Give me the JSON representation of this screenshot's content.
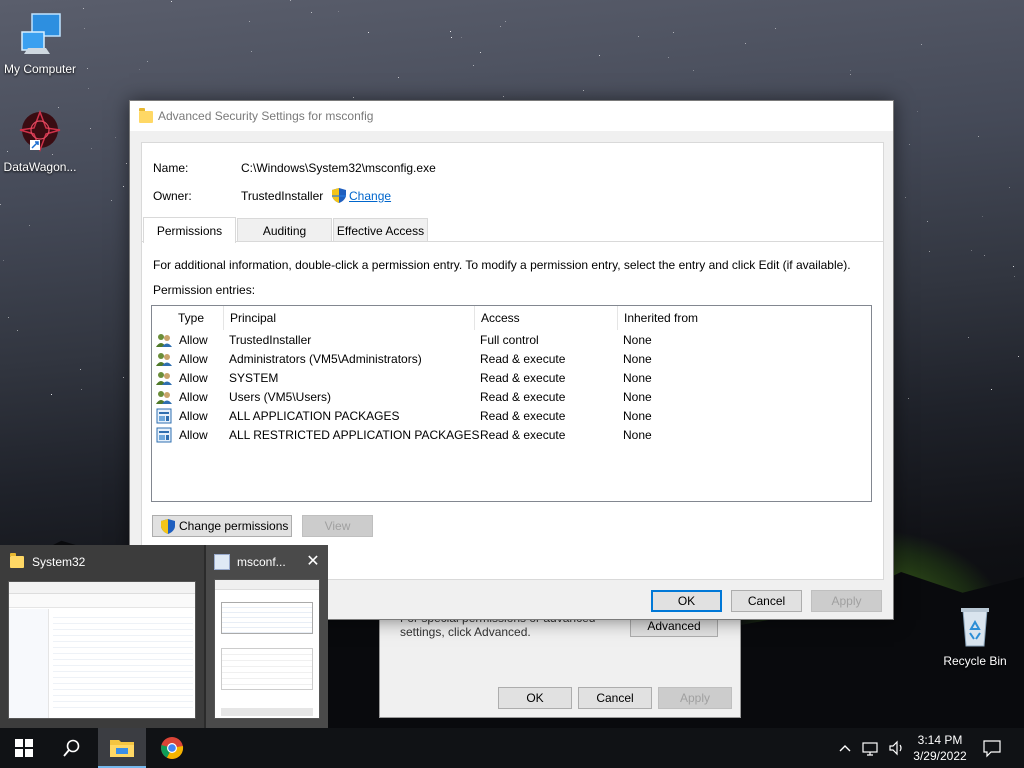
{
  "desktop": {
    "icons": [
      {
        "label": "My Computer"
      },
      {
        "label": "DataWagon..."
      },
      {
        "label": "Recycle Bin"
      }
    ]
  },
  "dialog": {
    "title": "Advanced Security Settings for msconfig",
    "name_label": "Name:",
    "name_value": "C:\\Windows\\System32\\msconfig.exe",
    "owner_label": "Owner:",
    "owner_value": "TrustedInstaller",
    "change_link": "Change",
    "tabs": [
      {
        "label": "Permissions",
        "active": true
      },
      {
        "label": "Auditing",
        "active": false
      },
      {
        "label": "Effective Access",
        "active": false
      }
    ],
    "info_text": "For additional information, double-click a permission entry. To modify a permission entry, select the entry and click Edit (if available).",
    "entries_label": "Permission entries:",
    "columns": [
      "Type",
      "Principal",
      "Access",
      "Inherited from"
    ],
    "rows": [
      {
        "icon": "user-group-icon",
        "type": "Allow",
        "principal": "TrustedInstaller",
        "access": "Full control",
        "inherited": "None"
      },
      {
        "icon": "user-group-icon",
        "type": "Allow",
        "principal": "Administrators (VM5\\Administrators)",
        "access": "Read & execute",
        "inherited": "None"
      },
      {
        "icon": "user-group-icon",
        "type": "Allow",
        "principal": "SYSTEM",
        "access": "Read & execute",
        "inherited": "None"
      },
      {
        "icon": "user-group-icon",
        "type": "Allow",
        "principal": "Users (VM5\\Users)",
        "access": "Read & execute",
        "inherited": "None"
      },
      {
        "icon": "app-package-icon",
        "type": "Allow",
        "principal": "ALL APPLICATION PACKAGES",
        "access": "Read & execute",
        "inherited": "None"
      },
      {
        "icon": "app-package-icon",
        "type": "Allow",
        "principal": "ALL RESTRICTED APPLICATION PACKAGES",
        "access": "Read & execute",
        "inherited": "None"
      }
    ],
    "change_permissions_label": "Change permissions",
    "view_label": "View",
    "ok_label": "OK",
    "cancel_label": "Cancel",
    "apply_label": "Apply"
  },
  "back_dialog": {
    "note": "For special permissions or advanced settings, click Advanced.",
    "advanced_label": "Advanced",
    "ok_label": "OK",
    "cancel_label": "Cancel",
    "apply_label": "Apply"
  },
  "thumbnails": [
    {
      "title": "System32"
    },
    {
      "title": "msconf..."
    }
  ],
  "taskbar": {
    "time": "3:14 PM",
    "date": "3/29/2022"
  },
  "colors": {
    "accent": "#0078d7",
    "link": "#0066cc",
    "taskbar": "#101215"
  }
}
